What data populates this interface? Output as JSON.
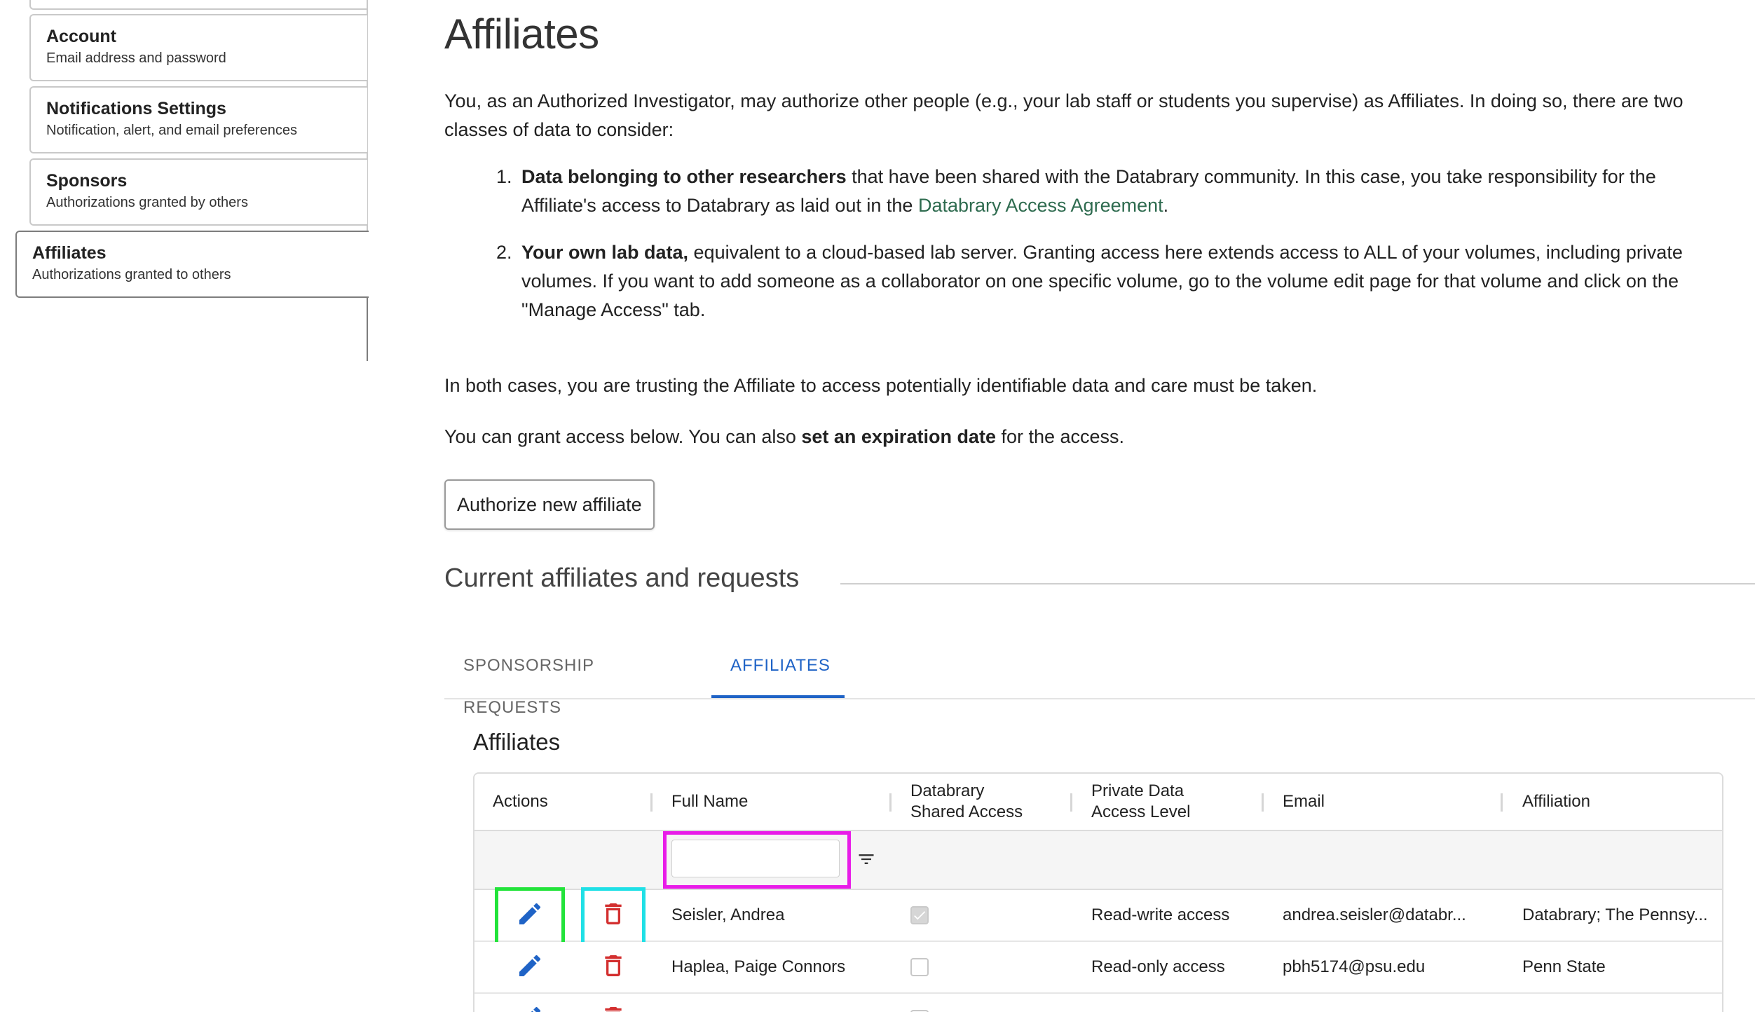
{
  "sidebar": {
    "items": [
      {
        "title": "Account",
        "subtitle": "Email address and password"
      },
      {
        "title": "Notifications Settings",
        "subtitle": "Notification, alert, and email preferences"
      },
      {
        "title": "Sponsors",
        "subtitle": "Authorizations granted by others"
      },
      {
        "title": "Affiliates",
        "subtitle": "Authorizations granted to others",
        "active": true
      }
    ]
  },
  "main": {
    "title": "Affiliates",
    "intro": "You, as an Authorized Investigator, may authorize other people (e.g., your lab staff or students you supervise) as Affiliates. In doing so, there are two classes of data to consider:",
    "list": [
      {
        "num": "1.",
        "bold": "Data belonging to other researchers",
        "text": " that have been shared with the Databrary community. In this case, you take responsibility for the Affiliate's access to Databrary as laid out in the ",
        "link": "Databrary Access Agreement",
        "tail": "."
      },
      {
        "num": "2.",
        "bold": "Your own lab data,",
        "text": " equivalent to a cloud-based lab server. Granting access here extends access to ALL of your volumes, including private volumes. If you want to add someone as a collaborator on one specific volume, go to the volume edit page for that volume and click on the \"Manage Access\" tab."
      }
    ],
    "both_cases": "In both cases, you are trusting the Affiliate to access potentially identifiable data and care must be taken.",
    "grant_pre": "You can grant access below. You can also ",
    "grant_bold": "set an expiration date",
    "grant_post": " for the access.",
    "authorize_button": "Authorize new affiliate",
    "section_heading": "Current affiliates and requests",
    "tabs": [
      {
        "label": "Sponsorship Requests"
      },
      {
        "label": "Affiliates",
        "active": true
      }
    ],
    "table_caption": "Affiliates"
  },
  "grid": {
    "columns": {
      "actions": "Actions",
      "full_name": "Full Name",
      "shared_access_1": "Databrary",
      "shared_access_2": "Shared Access",
      "private_1": "Private Data",
      "private_2": "Access Level",
      "email": "Email",
      "affiliation": "Affiliation"
    },
    "filter_value": "",
    "rows": [
      {
        "name": "Seisler, Andrea",
        "shared": true,
        "level": "Read-write access",
        "email": "andrea.seisler@databr...",
        "affiliation": "Databrary; The Pennsy..."
      },
      {
        "name": "Haplea, Paige Connors",
        "shared": false,
        "level": "Read-only access",
        "email": "pbh5174@psu.edu",
        "affiliation": "Penn State"
      }
    ]
  },
  "colors": {
    "accent": "#1f63c6",
    "link": "#2e6b4f",
    "edit": "#1f63c6",
    "delete": "#d32f2f",
    "highlight_green": "#22e33a",
    "highlight_cyan": "#1fe0e6",
    "highlight_magenta": "#e81ce8"
  },
  "icons": {
    "edit": "pencil-icon",
    "delete": "trash-icon",
    "filter": "filter-list-icon"
  }
}
